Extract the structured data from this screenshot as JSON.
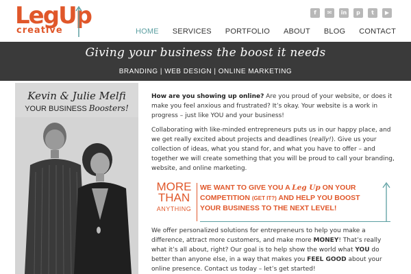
{
  "brand": {
    "logo_main": "LegUp",
    "logo_sub": "creative",
    "accent": "#e0572a",
    "teal": "#5a9ea0"
  },
  "social": [
    {
      "icon": "facebook-icon",
      "glyph": "f"
    },
    {
      "icon": "email-icon",
      "glyph": "✉"
    },
    {
      "icon": "linkedin-icon",
      "glyph": "in"
    },
    {
      "icon": "pinterest-icon",
      "glyph": "p"
    },
    {
      "icon": "twitter-icon",
      "glyph": "t"
    },
    {
      "icon": "youtube-icon",
      "glyph": "▶"
    }
  ],
  "nav": [
    "HOME",
    "SERVICES",
    "PORTFOLIO",
    "ABOUT",
    "BLOG",
    "CONTACT"
  ],
  "banner": {
    "tagline": "Giving your business the boost it needs",
    "sub": "BRANDING | WEB DESIGN | ONLINE MARKETING"
  },
  "left": {
    "heading": "Kevin & Julie Melfi",
    "sub_plain": "YOUR BUSINESS ",
    "sub_script": "Boosters!"
  },
  "content": {
    "p1_bold": "How are you showing up online?",
    "p1_rest": " Are you proud of your website, or does it make you feel anxious and frustrated? It’s okay. Your website is a work in progress – just like YOU and your business!",
    "p2_a": "Collaborating with like-minded entrepreneurs puts us in our happy place, and we get really excited about projects and deadlines (",
    "p2_italic": "really!",
    "p2_b": "). Give us your collection of ideas, what you stand for, and what you have to offer – and together we will create something that you will be proud to call your branding, website, and online marketing.",
    "p3_a": "We offer personalized solutions for entrepreneurs to help you make a difference, attract more customers, and make more ",
    "p3_money": "MONEY",
    "p3_b": "! That’s really what it’s all about, right?  Our goal is to help show the world what ",
    "p3_you": "YOU",
    "p3_c": " do better than anyone else, in a way that makes you ",
    "p3_feel": "FEEL GOOD",
    "p3_d": " about your online presence. ",
    "p3_link": "Contact us today – let’s get started!"
  },
  "callout": {
    "big1": "MORE",
    "big2": "THAN",
    "big3": "ANYTHING",
    "m1": "WE WANT TO GIVE YOU A ",
    "m_script": "Leg Up",
    "m2": " ON YOUR COMPETITION ",
    "m_small": "(GET IT?)",
    "m3": " AND HELP YOU BOOST YOUR BUSINESS TO THE NEXT LEVEL!"
  }
}
